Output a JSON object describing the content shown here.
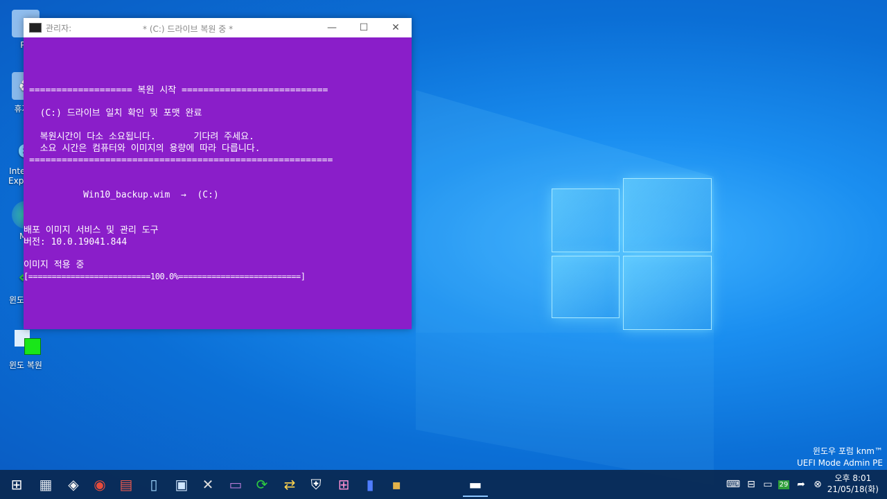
{
  "desktop": {
    "icons": [
      {
        "label": "PC",
        "icon": "pc-icon"
      },
      {
        "label": "휴지통",
        "icon": "recycle-bin-icon"
      },
      {
        "label": "Internet Explorer",
        "icon": "internet-explorer-icon"
      },
      {
        "label": "MS",
        "icon": "edge-icon"
      },
      {
        "label": "윈도 백업",
        "icon": "backup-icon"
      },
      {
        "label": "윈도 복원",
        "icon": "restore-icon"
      }
    ]
  },
  "console": {
    "admin_label": "관리자:",
    "title": "* (C:) 드라이브 복원 중 *",
    "minimize": "—",
    "maximize": "☐",
    "close": "✕",
    "lines": {
      "l1": "=================== 복원 시작 ===========================",
      "l2": "  (C:) 드라이브 일치 확인 및 포맷 완료",
      "l3": "  복원시간이 다소 소요됩니다.       기다려 주세요.",
      "l4": "  소요 시간은 컴퓨터와 이미지의 용량에 따라 다릅니다.",
      "l5": "========================================================",
      "l6": "           Win10_backup.wim  →  (C:)",
      "l7": "배포 이미지 서비스 및 관리 도구",
      "l8": "버전: 10.0.19041.844",
      "l9": "이미지 적용 중",
      "l10": "[==========================100.0%==========================]"
    },
    "progress_percent": 100.0
  },
  "watermark": {
    "line1": "윈도우 포럼 knm™",
    "line2": "UEFI Mode Admin PE"
  },
  "taskbar": {
    "apps": [
      {
        "name": "start-button",
        "icon": "windows-logo-icon"
      },
      {
        "name": "taskbar-app-monitor",
        "icon": "monitor-icon"
      },
      {
        "name": "taskbar-app-tools",
        "icon": "tools-icon"
      },
      {
        "name": "taskbar-app-globe",
        "icon": "globe-icon"
      },
      {
        "name": "taskbar-app-drive",
        "icon": "drive-icon"
      },
      {
        "name": "taskbar-app-file",
        "icon": "file-icon"
      },
      {
        "name": "taskbar-app-computer",
        "icon": "computer-icon"
      },
      {
        "name": "taskbar-app-settings",
        "icon": "wrench-icon"
      },
      {
        "name": "taskbar-app-screen",
        "icon": "screen-icon"
      },
      {
        "name": "taskbar-app-refresh",
        "icon": "refresh-icon"
      },
      {
        "name": "taskbar-app-network",
        "icon": "network-icon"
      },
      {
        "name": "taskbar-app-shield",
        "icon": "shield-icon"
      },
      {
        "name": "taskbar-app-store",
        "icon": "store-icon"
      },
      {
        "name": "taskbar-app-phone",
        "icon": "phone-icon"
      },
      {
        "name": "taskbar-app-chip",
        "icon": "chip-icon"
      }
    ],
    "active_window": "console-icon",
    "tray": {
      "badge": "29",
      "time": "오후 8:01",
      "date": "21/05/18(화)"
    }
  },
  "colors": {
    "console_bg": "#8a1ec9",
    "desktop_blue": "#0b6fd6",
    "taskbar": "#0a2850"
  }
}
